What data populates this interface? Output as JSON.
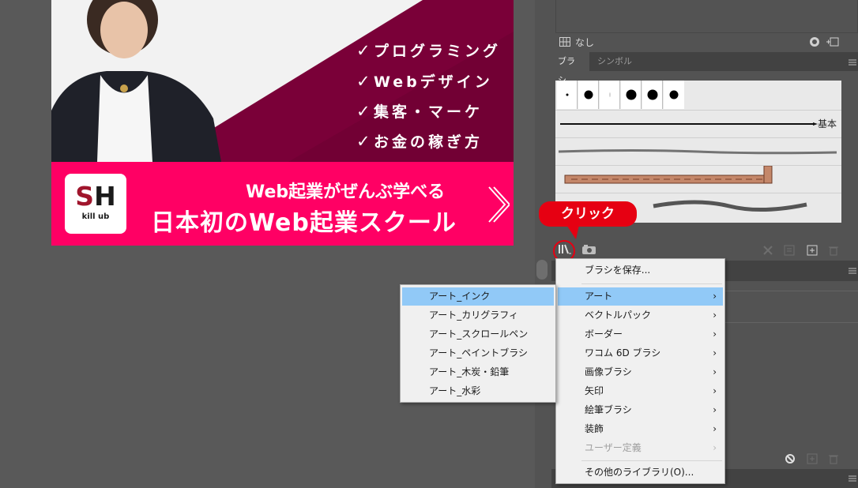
{
  "banner": {
    "features": [
      "プログラミング",
      "Webデザイン",
      "集客・マーケ",
      "お金の稼ぎ方"
    ],
    "check_mark": "✓",
    "logo_main_s": "S",
    "logo_main_h": "H",
    "logo_sub": "kill ub",
    "line1": "Web起業がぜんぶ学べる",
    "line2": "日本初のWeb起業スクール",
    "colors": {
      "maroon": "#7a0038",
      "pink": "#ff0064",
      "logo_red": "#a0152c"
    }
  },
  "swatch": {
    "label": "なし"
  },
  "brush_panel": {
    "tabs": [
      "ブラシ",
      "シンボル"
    ],
    "basic_label": "基本"
  },
  "callout": {
    "text": "クリック",
    "color": "#e60012"
  },
  "main_menu": {
    "save": "ブラシを保存...",
    "items": [
      {
        "label": "アート",
        "arrow": "›"
      },
      {
        "label": "ベクトルパック",
        "arrow": "›"
      },
      {
        "label": "ボーダー",
        "arrow": "›"
      },
      {
        "label": "ワコム 6D ブラシ",
        "arrow": "›"
      },
      {
        "label": "画像ブラシ",
        "arrow": "›"
      },
      {
        "label": "矢印",
        "arrow": "›"
      },
      {
        "label": "絵筆ブラシ",
        "arrow": "›"
      },
      {
        "label": "装飾",
        "arrow": "›"
      },
      {
        "label": "ユーザー定義",
        "arrow": "›"
      }
    ],
    "other": "その他のライブラリ(O)..."
  },
  "sub_menu": {
    "items": [
      "アート_インク",
      "アート_カリグラフィ",
      "アート_スクロールペン",
      "アート_ペイントブラシ",
      "アート_木炭・鉛筆",
      "アート_水彩"
    ]
  }
}
